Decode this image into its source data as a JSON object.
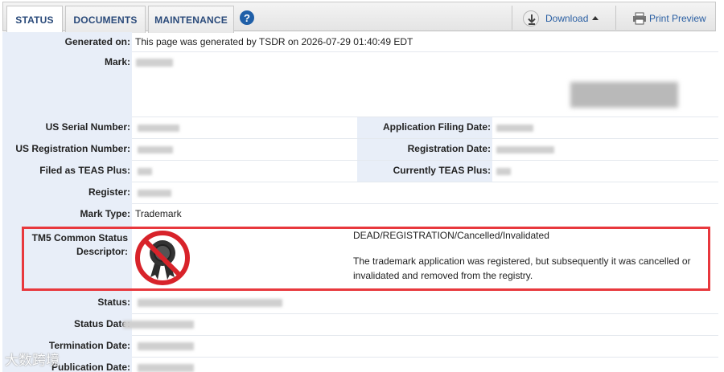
{
  "tabs": [
    {
      "label": "STATUS",
      "active": true
    },
    {
      "label": "DOCUMENTS",
      "active": false
    },
    {
      "label": "MAINTENANCE",
      "active": false
    }
  ],
  "help_glyph": "?",
  "toolbar": {
    "download_label": "Download",
    "download_icon": "download-arrow-icon",
    "print_label": "Print Preview",
    "print_icon": "printer-icon"
  },
  "fields": {
    "generated_on_label": "Generated on:",
    "generated_on_value": "This page was generated by TSDR on 2026-07-29 01:40:49 EDT",
    "mark_label": "Mark:",
    "serial_label": "US Serial Number:",
    "filing_date_label": "Application Filing Date:",
    "reg_number_label": "US Registration Number:",
    "reg_date_label": "Registration Date:",
    "teas_plus_label": "Filed as TEAS Plus:",
    "currently_teas_label": "Currently TEAS Plus:",
    "register_label": "Register:",
    "mark_type_label": "Mark Type:",
    "mark_type_value": "Trademark",
    "status_label": "Status:",
    "status_date_label": "Status Date:",
    "termination_label": "Termination Date:",
    "publication_label": "Publication Date:"
  },
  "tm5": {
    "label": "TM5 Common Status Descriptor:",
    "icon": "cancelled-seal-icon",
    "status": "DEAD/REGISTRATION/Cancelled/Invalidated",
    "description": "The trademark application was registered, but subsequently it was cancelled or invalidated and removed from the registry.",
    "highlight_color": "#e8383d"
  },
  "watermark": "大数跨境",
  "colors": {
    "label_bg": "#e8eef8",
    "link": "#2a4a7a"
  }
}
